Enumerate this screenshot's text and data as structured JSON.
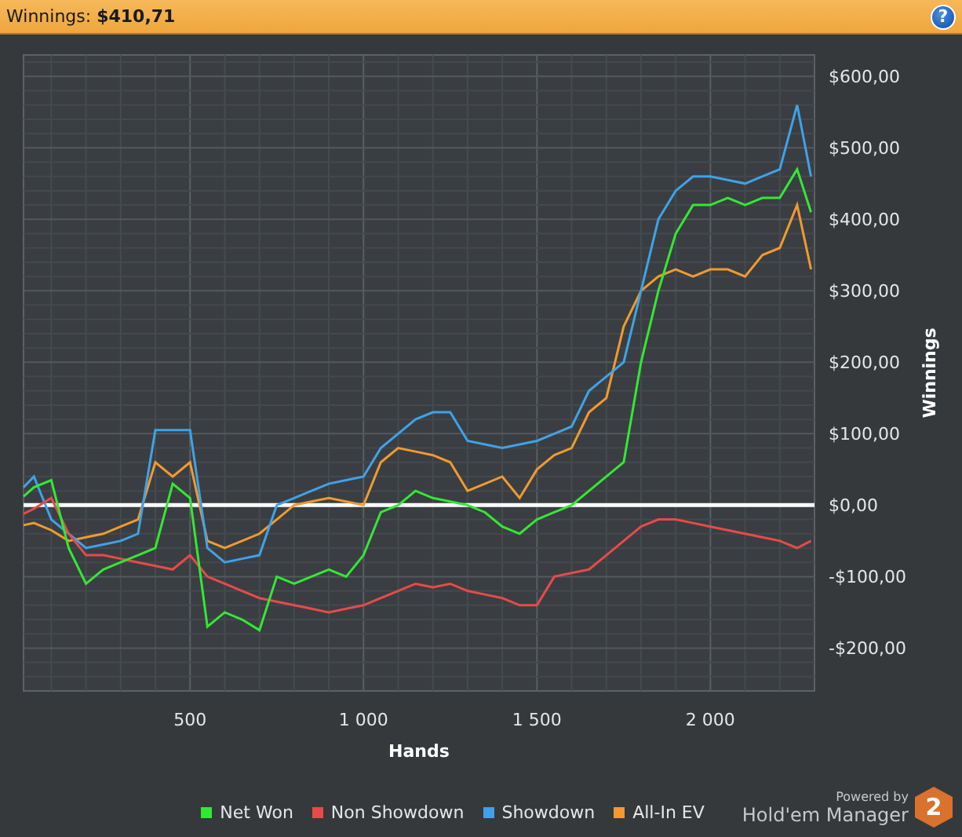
{
  "header": {
    "title": "Winnings: **$410,71**",
    "help": "?"
  },
  "chart": {
    "chart_data": {
      "type": "line",
      "grid": true,
      "xlabel": "Hands",
      "ylabel": "Winnings",
      "xlim": [
        20,
        2300
      ],
      "ylim": [
        -260,
        630
      ],
      "xticks": [
        {
          "value": 500,
          "label": "500"
        },
        {
          "value": 1000,
          "label": "1 000"
        },
        {
          "value": 1500,
          "label": "1 500"
        },
        {
          "value": 2000,
          "label": "2 000"
        }
      ],
      "yticks": [
        {
          "value": 600,
          "label": "$600,00"
        },
        {
          "value": 500,
          "label": "$500,00"
        },
        {
          "value": 400,
          "label": "$400,00"
        },
        {
          "value": 300,
          "label": "$300,00"
        },
        {
          "value": 200,
          "label": "$200,00"
        },
        {
          "value": 100,
          "label": "$100,00"
        },
        {
          "value": 0,
          "label": "$0,00"
        },
        {
          "value": -100,
          "label": "-$100,00"
        },
        {
          "value": -200,
          "label": "-$200,00"
        }
      ],
      "x": [
        20,
        50,
        100,
        150,
        200,
        250,
        300,
        350,
        400,
        450,
        500,
        550,
        600,
        650,
        700,
        750,
        800,
        850,
        900,
        950,
        1000,
        1050,
        1100,
        1150,
        1200,
        1250,
        1300,
        1350,
        1400,
        1450,
        1500,
        1550,
        1600,
        1650,
        1700,
        1750,
        1800,
        1850,
        1900,
        1950,
        2000,
        2050,
        2100,
        2150,
        2200,
        2250,
        2290
      ],
      "series": [
        {
          "name": "Net Won",
          "color": "#33e833",
          "values": [
            12,
            25,
            35,
            -60,
            -110,
            -90,
            -80,
            -70,
            -60,
            30,
            10,
            -170,
            -150,
            -160,
            -175,
            -100,
            -110,
            -100,
            -90,
            -100,
            -70,
            -10,
            0,
            20,
            10,
            5,
            0,
            -10,
            -30,
            -40,
            -20,
            -10,
            0,
            20,
            40,
            60,
            200,
            300,
            380,
            420,
            420,
            430,
            420,
            430,
            430,
            470,
            410
          ]
        },
        {
          "name": "Non Showdown",
          "color": "#e84a4a",
          "values": [
            -12,
            -5,
            10,
            -40,
            -70,
            -70,
            -75,
            -80,
            -85,
            -90,
            -70,
            -100,
            -110,
            -120,
            -130,
            -135,
            -140,
            -145,
            -150,
            -145,
            -140,
            -130,
            -120,
            -110,
            -115,
            -110,
            -120,
            -125,
            -130,
            -140,
            -140,
            -100,
            -95,
            -90,
            -70,
            -50,
            -30,
            -20,
            -20,
            -25,
            -30,
            -35,
            -40,
            -45,
            -50,
            -60,
            -50
          ]
        },
        {
          "name": "Showdown",
          "color": "#3fa2e8",
          "values": [
            25,
            40,
            -20,
            -40,
            -60,
            -55,
            -50,
            -40,
            105,
            105,
            105,
            -60,
            -80,
            -75,
            -70,
            0,
            10,
            20,
            30,
            35,
            40,
            80,
            100,
            120,
            130,
            130,
            90,
            85,
            80,
            85,
            90,
            100,
            110,
            160,
            180,
            200,
            300,
            400,
            440,
            460,
            460,
            455,
            450,
            460,
            470,
            560,
            460
          ]
        },
        {
          "name": "All-In EV",
          "color": "#f09a30",
          "values": [
            -28,
            -25,
            -35,
            -50,
            -45,
            -40,
            -30,
            -20,
            60,
            40,
            60,
            -50,
            -60,
            -50,
            -40,
            -20,
            0,
            5,
            10,
            5,
            0,
            60,
            80,
            75,
            70,
            60,
            20,
            30,
            40,
            10,
            50,
            70,
            80,
            130,
            150,
            250,
            300,
            320,
            330,
            320,
            330,
            330,
            320,
            350,
            360,
            420,
            330
          ]
        }
      ]
    }
  },
  "branding": {
    "powered_by": "Powered by",
    "product": "Hold'em Manager",
    "version": "2"
  }
}
